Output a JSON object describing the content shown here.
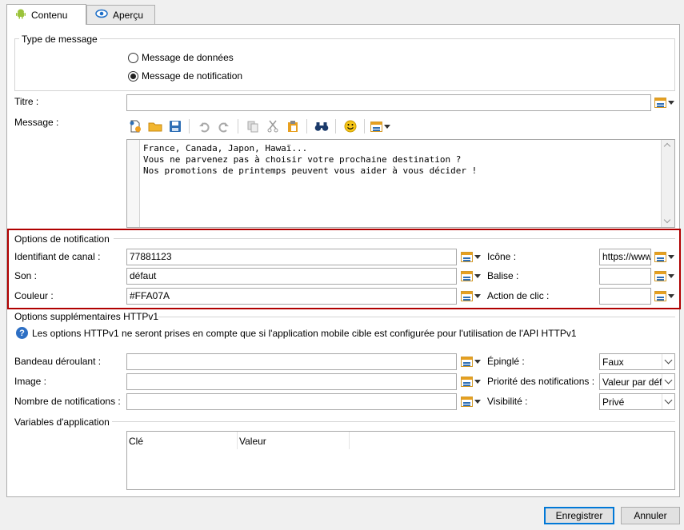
{
  "tabs": [
    {
      "label": "Contenu",
      "icon": "android-icon",
      "active": true
    },
    {
      "label": "Aperçu",
      "icon": "eye-icon",
      "active": false
    }
  ],
  "message_type": {
    "legend": "Type de message",
    "options": [
      {
        "label": "Message de données",
        "checked": false
      },
      {
        "label": "Message de notification",
        "checked": true
      }
    ]
  },
  "title_field": {
    "label": "Titre :",
    "value": ""
  },
  "message_field": {
    "label": "Message :",
    "text": "France, Canada, Japon, Hawaï...\nVous ne parvenez pas à choisir votre prochaine destination ?\nNos promotions de printemps peuvent vous aider à vous décider !"
  },
  "toolbar_icons": [
    "new-icon",
    "open-folder-icon",
    "save-icon",
    "undo-icon",
    "redo-icon",
    "copy-icon",
    "cut-icon",
    "paste-icon",
    "find-icon",
    "emoji-icon",
    "insert-field-icon"
  ],
  "notification_options": {
    "legend": "Options de notification",
    "channel_id": {
      "label": "Identifiant de canal :",
      "value": "77881123"
    },
    "sound": {
      "label": "Son :",
      "value": "défaut"
    },
    "color": {
      "label": "Couleur :",
      "value": "#FFA07A"
    },
    "icon": {
      "label": "Icône :",
      "value": "https://www"
    },
    "tag": {
      "label": "Balise :",
      "value": ""
    },
    "click_action": {
      "label": "Action de clic :",
      "value": ""
    }
  },
  "extra_options": {
    "legend": "Options supplémentaires HTTPv1",
    "info": "Les options HTTPv1 ne seront prises en compte que si l'application mobile cible est configurée pour l'utilisation de l'API HTTPv1",
    "ticker": {
      "label": "Bandeau déroulant :",
      "value": ""
    },
    "image": {
      "label": "Image :",
      "value": ""
    },
    "notification_count": {
      "label": "Nombre de notifications :",
      "value": ""
    },
    "pinned": {
      "label": "Épinglé :",
      "value": "Faux"
    },
    "priority": {
      "label": "Priorité des notifications :",
      "value": "Valeur par défaut"
    },
    "visibility": {
      "label": "Visibilité :",
      "value": "Privé"
    }
  },
  "app_variables": {
    "legend": "Variables d'application",
    "columns": [
      "Clé",
      "Valeur"
    ]
  },
  "buttons": {
    "save": "Enregistrer",
    "cancel": "Annuler"
  },
  "colors": {
    "highlight_frame": "#b00000",
    "info_blue": "#2d6fc4"
  }
}
